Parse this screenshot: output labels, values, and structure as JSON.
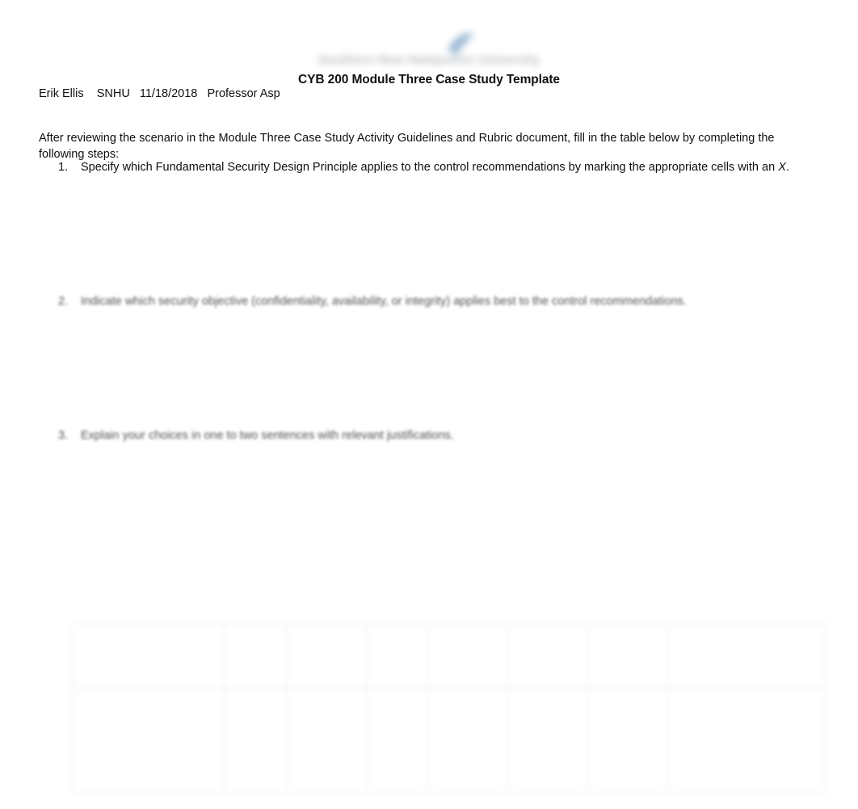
{
  "letterhead": {
    "wordmark": "Southern New Hampshire University",
    "logo_icon": "snhu-swoosh-icon",
    "accent_color": "#5b8db8"
  },
  "document": {
    "title": "CYB 200 Module Three Case Study Template",
    "byline": "Erik Ellis    SNHU   11/18/2018   Professor Asp",
    "intro": "After reviewing the scenario in the Module Three Case Study Activity Guidelines and Rubric document, fill in the table below by completing the following steps:"
  },
  "steps": [
    {
      "number": "1.",
      "text_before": "Specify which Fundamental Security Design Principle applies to the control recommendations by marking the appropriate cells with an ",
      "emphasis": "X",
      "text_after": "."
    },
    {
      "number": "2.",
      "text": "Indicate which security objective (confidentiality, availability, or integrity) applies best to the control recommendations."
    },
    {
      "number": "3.",
      "text": "Explain your choices in one to two sentences with relevant justifications."
    }
  ],
  "table": {
    "columns": [
      "",
      "",
      "",
      "",
      "",
      "",
      "",
      ""
    ],
    "rows": [
      [
        "",
        "",
        "",
        "",
        "",
        "",
        "",
        ""
      ],
      [
        "",
        "",
        "",
        "",
        "",
        "",
        "",
        ""
      ]
    ]
  }
}
